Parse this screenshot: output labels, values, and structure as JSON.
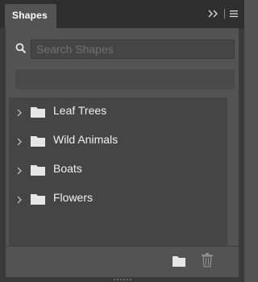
{
  "panel": {
    "tab_title": "Shapes"
  },
  "title_controls": {
    "collapse_icon": "double-chevron-right-icon",
    "menu_icon": "hamburger-menu-icon"
  },
  "search": {
    "icon": "search-icon",
    "placeholder": "Search Shapes",
    "value": ""
  },
  "groups": [
    {
      "label": "Leaf Trees",
      "icon": "folder-icon",
      "expander": "chevron-right-icon"
    },
    {
      "label": "Wild Animals",
      "icon": "folder-icon",
      "expander": "chevron-right-icon"
    },
    {
      "label": "Boats",
      "icon": "folder-icon",
      "expander": "chevron-right-icon"
    },
    {
      "label": "Flowers",
      "icon": "folder-icon",
      "expander": "chevron-right-icon"
    }
  ],
  "footer": {
    "new_group_icon": "new-group-folder-icon",
    "delete_icon": "trash-icon"
  },
  "colors": {
    "panel_bg": "#535353",
    "titlebar_bg": "#2f2f2f",
    "list_bg": "#454545",
    "text": "#f0f0f0",
    "icon": "#e6e6e6"
  }
}
